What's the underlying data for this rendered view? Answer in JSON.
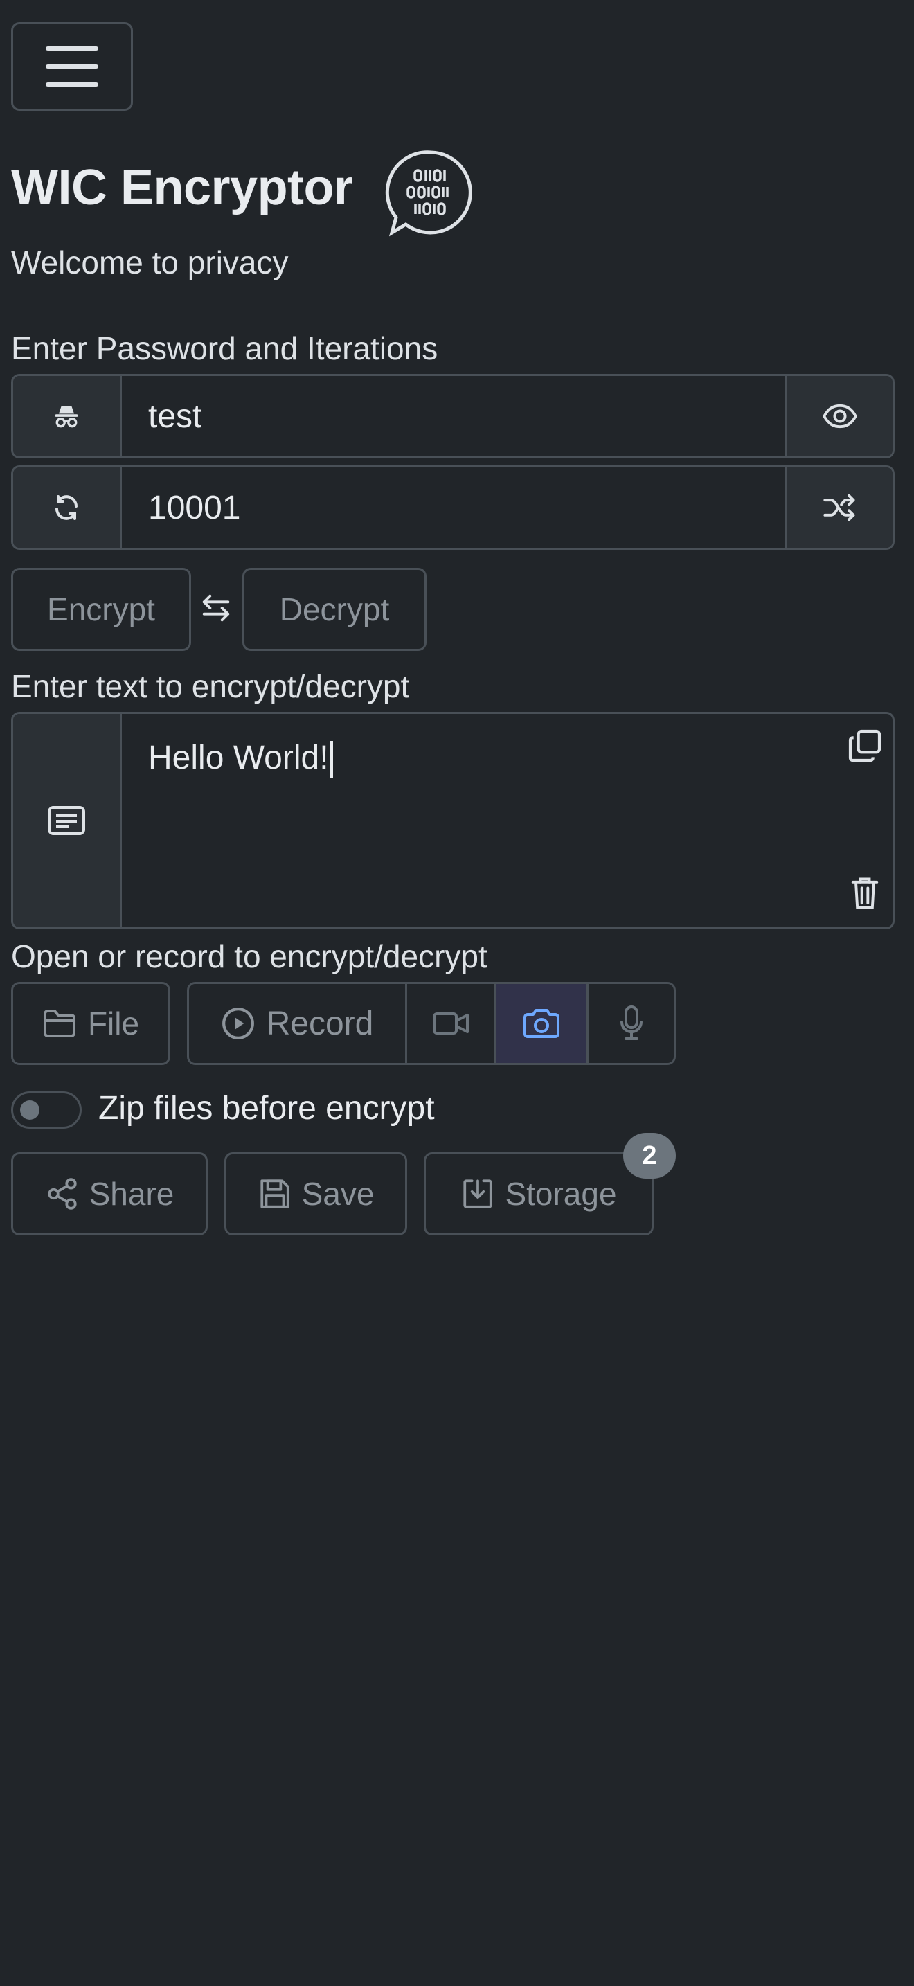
{
  "header": {
    "title": "WIC Encryptor",
    "subtitle": "Welcome to privacy",
    "menu_icon": "hamburger-icon",
    "logo_icon": "binary-chat-logo"
  },
  "password_section": {
    "label": "Enter Password and Iterations",
    "password": {
      "value": "test",
      "left_icon": "incognito-icon",
      "right_icon": "eye-icon"
    },
    "iterations": {
      "value": "10001",
      "left_icon": "refresh-icon",
      "right_icon": "shuffle-icon"
    }
  },
  "mode": {
    "encrypt_label": "Encrypt",
    "swap_icon": "swap-arrows-icon",
    "decrypt_label": "Decrypt"
  },
  "text_section": {
    "label": "Enter text to encrypt/decrypt",
    "value": "Hello World!",
    "left_icon": "text-icon",
    "copy_icon": "copy-icon",
    "clear_icon": "trash-icon"
  },
  "media_section": {
    "label": "Open or record to encrypt/decrypt",
    "file_label": "File",
    "record_label": "Record",
    "selected_source": "camera"
  },
  "zip": {
    "label": "Zip files before encrypt",
    "enabled": false
  },
  "actions": {
    "share_label": "Share",
    "save_label": "Save",
    "storage_label": "Storage",
    "storage_badge": "2"
  },
  "colors": {
    "background": "#212529",
    "border": "#495057",
    "addon": "#2b3035",
    "muted_text": "#8d949b",
    "camera_selected": "#31324a",
    "camera_icon": "#6ea8fe",
    "badge": "#6c757d"
  }
}
